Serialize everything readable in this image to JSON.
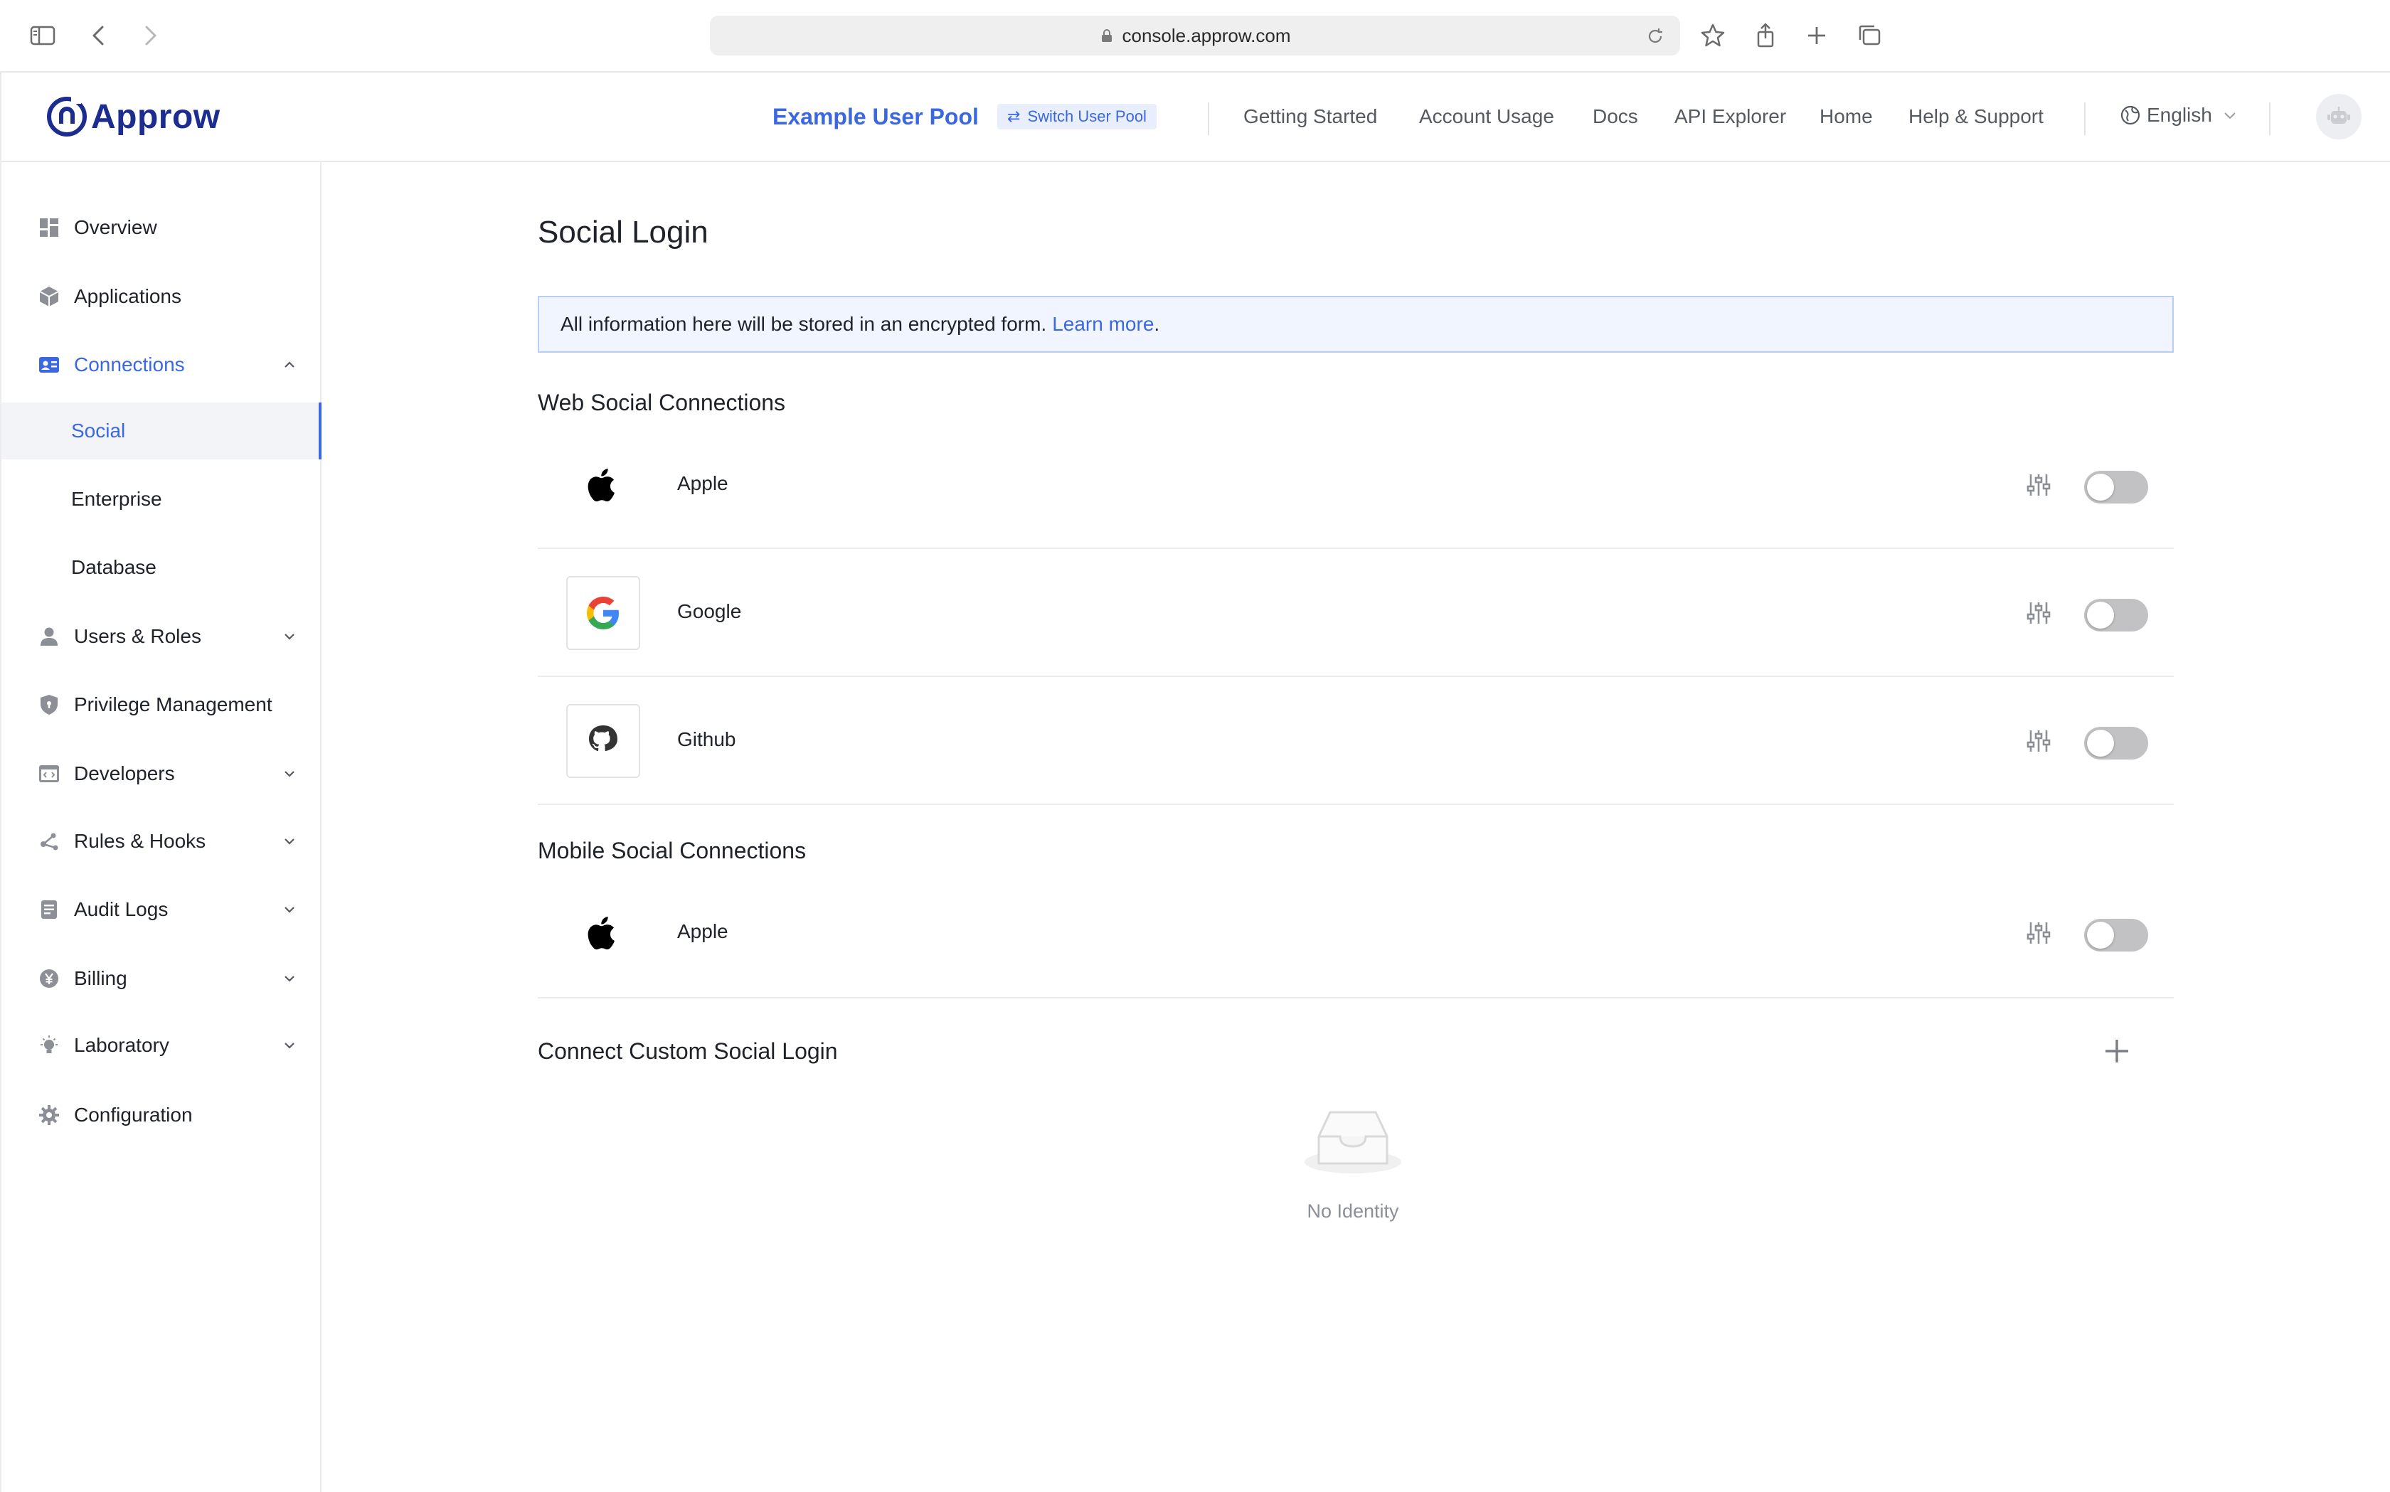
{
  "browser": {
    "url": "console.approw.com"
  },
  "header": {
    "logo_text": "Approw",
    "pool_name": "Example User Pool",
    "switch_pool": "Switch User Pool",
    "nav": [
      "Getting Started",
      "Account Usage",
      "Docs",
      "API Explorer",
      "Home",
      "Help & Support"
    ],
    "language": "English"
  },
  "sidebar": {
    "items": [
      {
        "label": "Overview",
        "icon": "dashboard-icon"
      },
      {
        "label": "Applications",
        "icon": "cube-icon"
      },
      {
        "label": "Connections",
        "icon": "id-card-icon",
        "expanded": true
      },
      {
        "label": "Social",
        "selected": true
      },
      {
        "label": "Enterprise"
      },
      {
        "label": "Database"
      },
      {
        "label": "Users & Roles",
        "icon": "user-icon"
      },
      {
        "label": "Privilege Management",
        "icon": "shield-icon"
      },
      {
        "label": "Developers",
        "icon": "code-window-icon"
      },
      {
        "label": "Rules & Hooks",
        "icon": "hook-nodes-icon"
      },
      {
        "label": "Audit Logs",
        "icon": "document-icon"
      },
      {
        "label": "Billing",
        "icon": "yen-coin-icon"
      },
      {
        "label": "Laboratory",
        "icon": "bulb-icon"
      },
      {
        "label": "Configuration",
        "icon": "gear-icon"
      }
    ]
  },
  "main": {
    "title": "Social Login",
    "banner_text": "All information here will be stored in an encrypted form.",
    "banner_link": "Learn more",
    "banner_period": ".",
    "web_section": "Web Social Connections",
    "web_connections": [
      {
        "name": "Apple",
        "icon": "apple-icon",
        "enabled": false
      },
      {
        "name": "Google",
        "icon": "google-icon",
        "enabled": false
      },
      {
        "name": "Github",
        "icon": "github-icon",
        "enabled": false
      }
    ],
    "mobile_section": "Mobile Social Connections",
    "mobile_connections": [
      {
        "name": "Apple",
        "icon": "apple-icon",
        "enabled": false
      }
    ],
    "custom_section": "Connect Custom Social Login",
    "empty_text": "No Identity"
  },
  "colors": {
    "accent": "#3b68e0",
    "brand": "#1d2d8f",
    "toggle_off": "#c2c2c4"
  }
}
